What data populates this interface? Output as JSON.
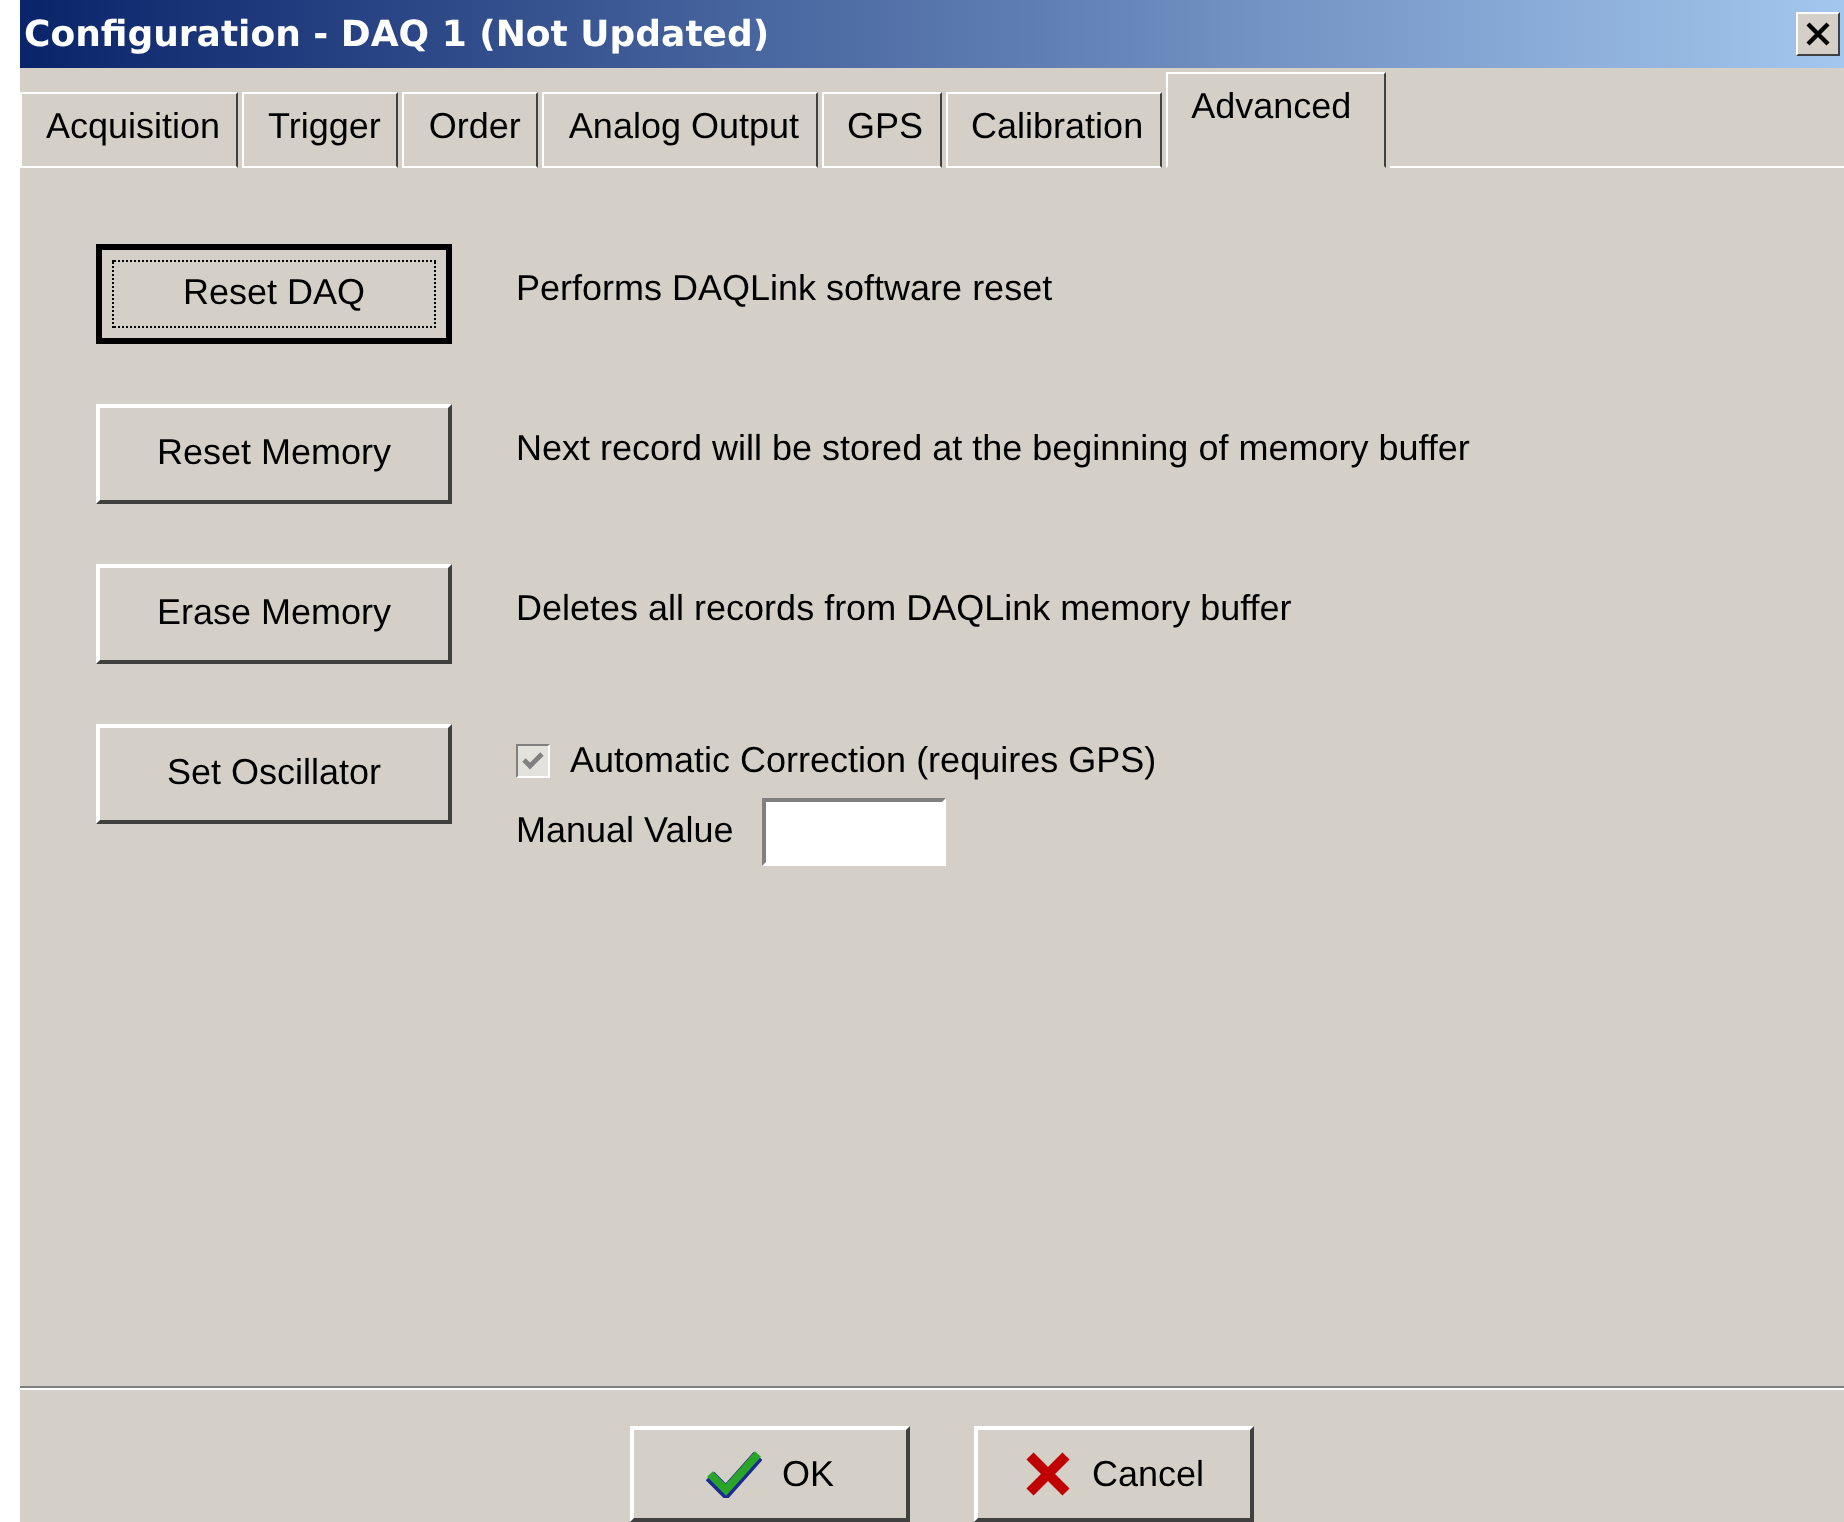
{
  "window": {
    "title": "Configuration - DAQ 1 (Not Updated)"
  },
  "tabs": [
    {
      "label": "Acquisition",
      "selected": false
    },
    {
      "label": "Trigger",
      "selected": false
    },
    {
      "label": "Order",
      "selected": false
    },
    {
      "label": "Analog Output",
      "selected": false
    },
    {
      "label": "GPS",
      "selected": false
    },
    {
      "label": "Calibration",
      "selected": false
    },
    {
      "label": "Advanced",
      "selected": true
    }
  ],
  "actions": [
    {
      "label": "Reset DAQ",
      "focused": true,
      "description": "Performs DAQLink software reset"
    },
    {
      "label": "Reset Memory",
      "focused": false,
      "description": "Next record will be stored at the beginning of memory buffer"
    },
    {
      "label": "Erase Memory",
      "focused": false,
      "description": "Deletes all records from DAQLink memory buffer"
    },
    {
      "label": "Set Oscillator",
      "focused": false,
      "checkbox": {
        "label": "Automatic Correction (requires GPS)",
        "checked": true,
        "disabled": true
      },
      "manual_value": {
        "label": "Manual Value"
      }
    }
  ],
  "buttons": [
    {
      "label": "OK",
      "kind": "ok"
    },
    {
      "label": "Cancel",
      "kind": "cancel"
    }
  ]
}
